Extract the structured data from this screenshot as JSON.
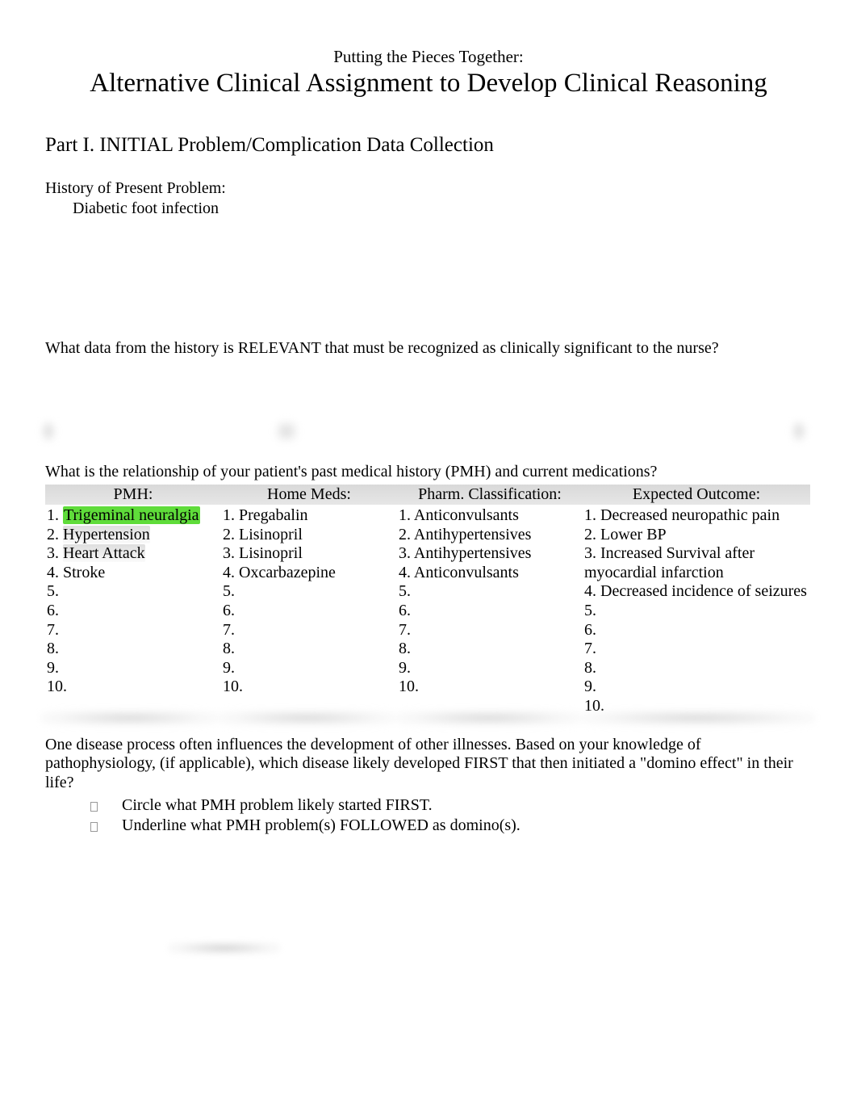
{
  "header": {
    "subtitle": "Putting the Pieces Together:",
    "title": "Alternative Clinical Assignment to Develop Clinical Reasoning"
  },
  "part1": {
    "heading": "Part I. INITIAL Problem/Complication Data Collection",
    "history_label": "History of Present Problem:",
    "history_value": "Diabetic foot infection",
    "relevant_prompt": "What data from the history is RELEVANT that must be recognized as clinically significant to the nurse?",
    "pmh_question": "What is the relationship of your patient's past medical history (PMH) and current medications?",
    "table": {
      "headers": {
        "pmh": "PMH:",
        "meds": "Home Meds:",
        "pharm": "Pharm. Classification:",
        "outcome": "Expected Outcome:"
      },
      "pmh": [
        {
          "n": "1.",
          "text": "Trigeminal neuralgia",
          "hl": "green"
        },
        {
          "n": "2.",
          "text": "Hypertension",
          "hl": "grey"
        },
        {
          "n": "3.",
          "text": "Heart Attack",
          "hl": "grey"
        },
        {
          "n": "4.",
          "text": "Stroke"
        },
        {
          "n": "5.",
          "text": ""
        },
        {
          "n": "6.",
          "text": ""
        },
        {
          "n": "7.",
          "text": ""
        },
        {
          "n": "8.",
          "text": ""
        },
        {
          "n": "9.",
          "text": ""
        },
        {
          "n": "10.",
          "text": ""
        }
      ],
      "meds": [
        {
          "n": "1.",
          "text": "Pregabalin"
        },
        {
          "n": "2.",
          "text": "Lisinopril"
        },
        {
          "n": "3.",
          "text": "Lisinopril"
        },
        {
          "n": "4.",
          "text": "Oxcarbazepine"
        },
        {
          "n": "5.",
          "text": ""
        },
        {
          "n": "6.",
          "text": ""
        },
        {
          "n": "7.",
          "text": ""
        },
        {
          "n": "8.",
          "text": ""
        },
        {
          "n": "9.",
          "text": ""
        },
        {
          "n": "10.",
          "text": ""
        }
      ],
      "pharm": [
        {
          "n": "1.",
          "text": "Anticonvulsants"
        },
        {
          "n": "2.",
          "text": "Antihypertensives"
        },
        {
          "n": "3.",
          "text": "Antihypertensives"
        },
        {
          "n": "4.",
          "text": "Anticonvulsants"
        },
        {
          "n": "5.",
          "text": ""
        },
        {
          "n": "6.",
          "text": ""
        },
        {
          "n": "7.",
          "text": ""
        },
        {
          "n": "8.",
          "text": ""
        },
        {
          "n": "9.",
          "text": ""
        },
        {
          "n": "10.",
          "text": ""
        }
      ],
      "outcome": [
        {
          "n": "1.",
          "text": "Decreased neuropathic pain"
        },
        {
          "n": "2.",
          "text": "Lower BP"
        },
        {
          "n": "3.",
          "text": "Increased Survival after myocardial infarction"
        },
        {
          "n": "4.",
          "text": "Decreased incidence of seizures"
        },
        {
          "n": "5.",
          "text": ""
        },
        {
          "n": "6.",
          "text": ""
        },
        {
          "n": "7.",
          "text": ""
        },
        {
          "n": "8.",
          "text": ""
        },
        {
          "n": "9.",
          "text": ""
        },
        {
          "n": "10.",
          "text": ""
        }
      ]
    },
    "domino_para": "One disease process often influences the development of other illnesses. Based on your knowledge of pathophysiology, (if applicable), which disease likely developed FIRST that then initiated a \"domino effect\" in their life?",
    "domino_items": [
      "Circle what PMH problem likely started FIRST.",
      "Underline what PMH problem(s) FOLLOWED   as domino(s)."
    ]
  }
}
